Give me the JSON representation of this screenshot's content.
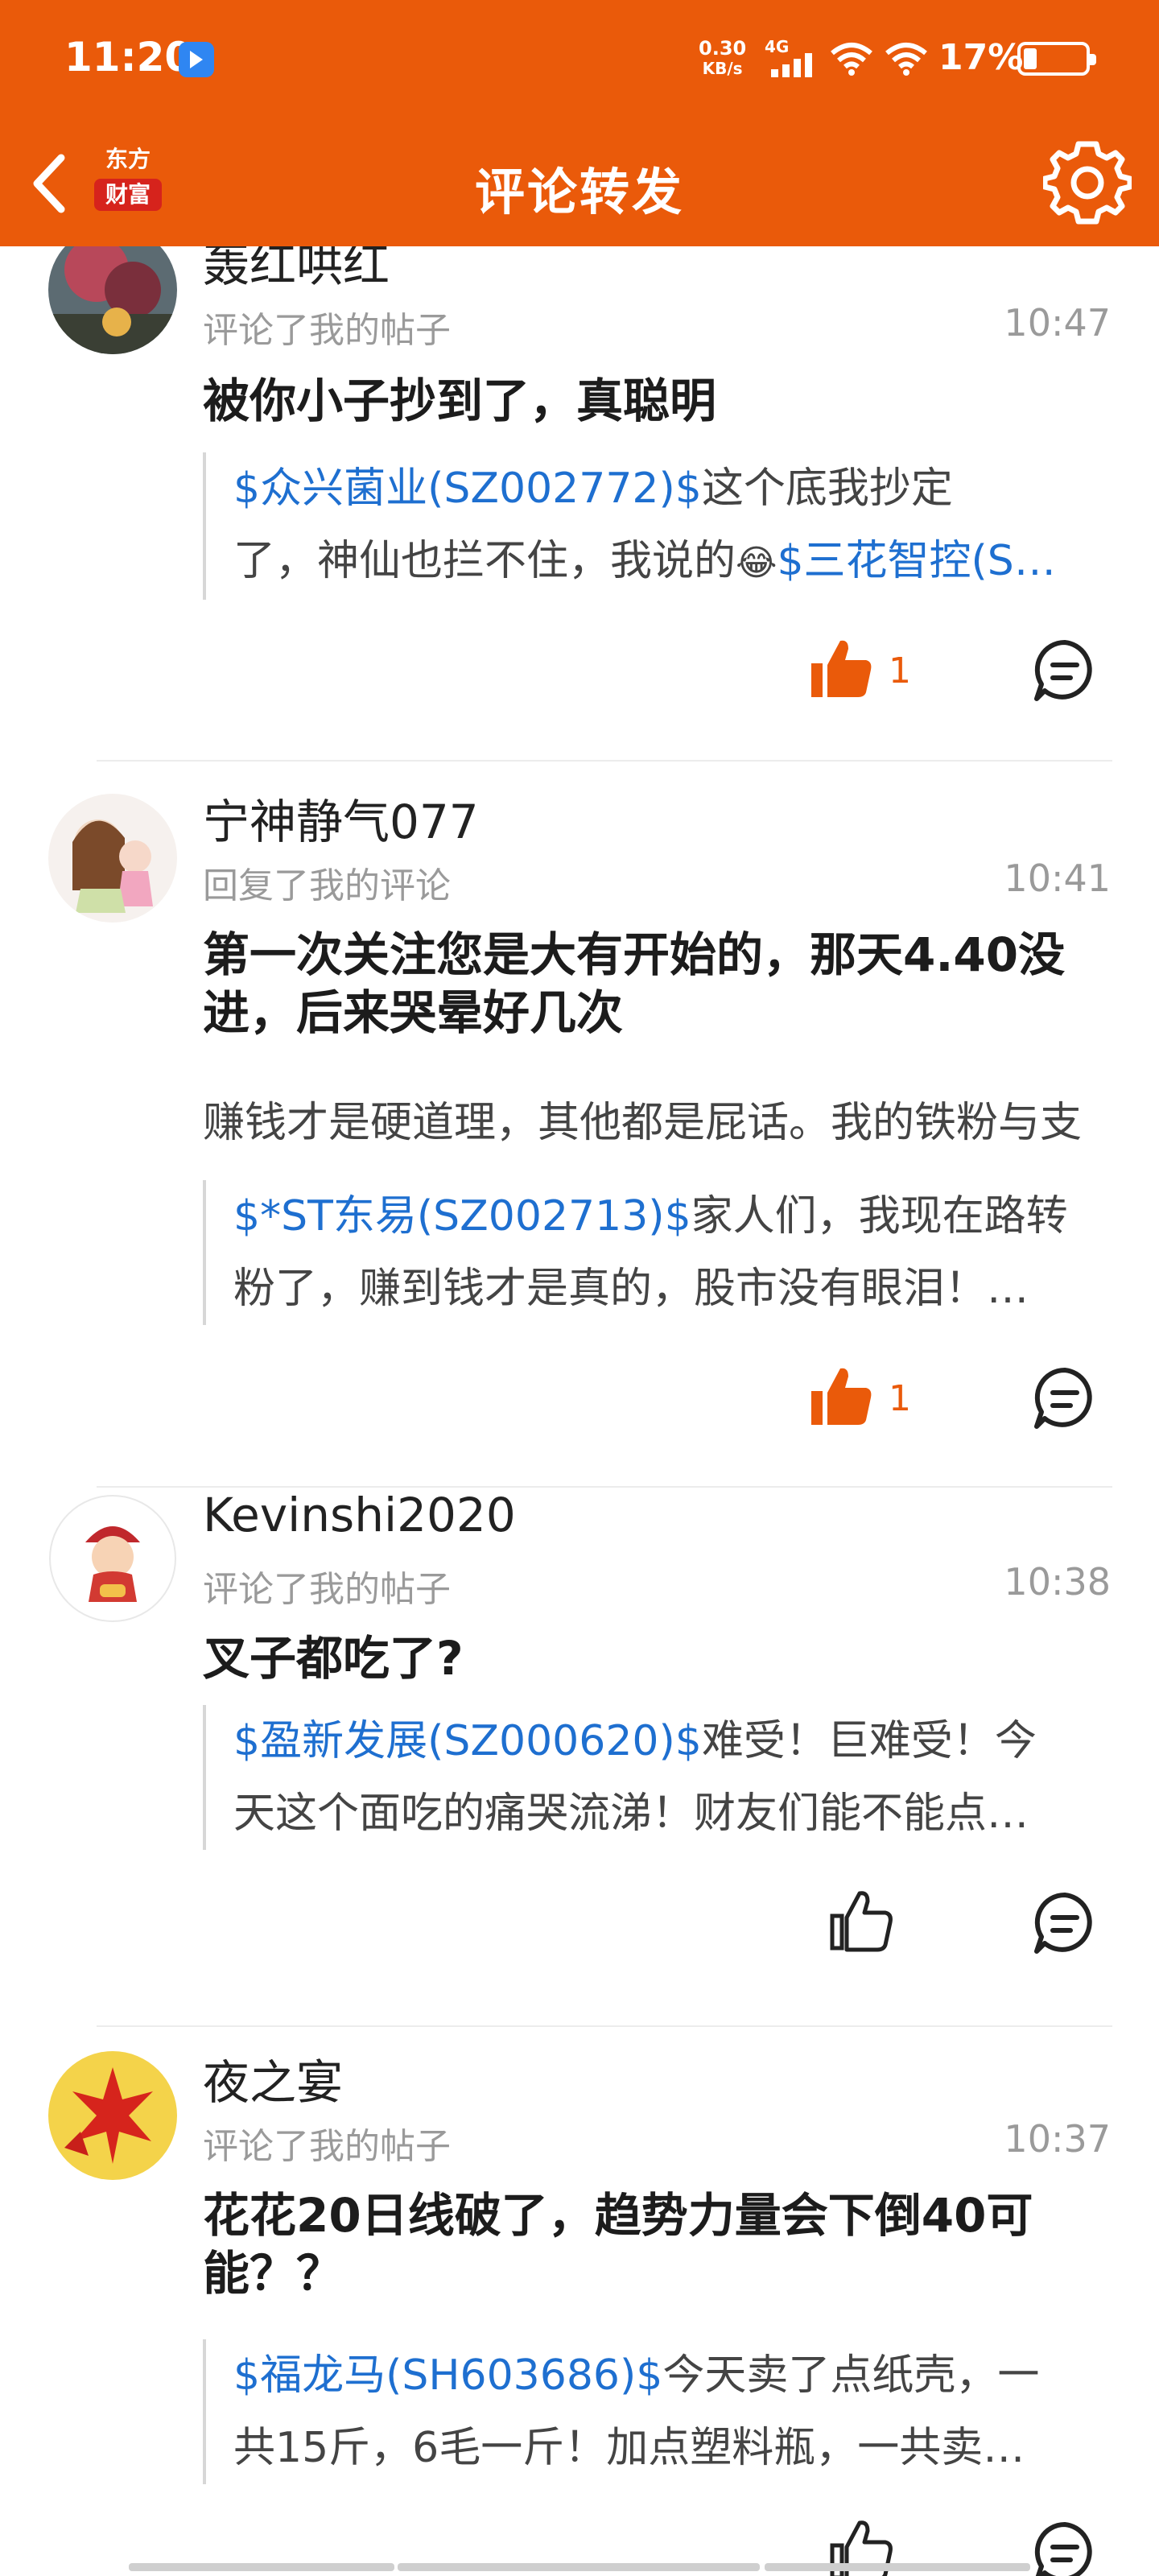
{
  "status_bar": {
    "time": "11:20",
    "net_speed_value": "0.30",
    "net_speed_unit": "KB/s",
    "network": "4G",
    "battery": "17%"
  },
  "header": {
    "logo_line1": "东方",
    "logo_line2": "财富",
    "title": "评论转发",
    "accent_color": "#ea5a0a"
  },
  "items": [
    {
      "user": "轰红哄红",
      "action": "评论了我的帖子",
      "time": "10:47",
      "comment": "被你小子抄到了，真聪明",
      "quote_stock": "$众兴菌业(SZ002772)$",
      "quote_line1": "这个底我抄定",
      "quote_line2": "了，神仙也拦不住，我说的",
      "quote_emoji": "😂",
      "quote_stock2": "$三花智控(S…",
      "likes": "1",
      "liked": true
    },
    {
      "user": "宁神静气077",
      "action": "回复了我的评论",
      "time": "10:41",
      "comment": "第一次关注您是大有开始的，那天4.40没进，后来哭晕好几次",
      "sub": "赚钱才是硬道理，其他都是屁话。我的铁粉与支",
      "quote_stock": "$*ST东易(SZ002713)$",
      "quote_line1": "家人们，我现在路转",
      "quote_line2": "粉了，赚到钱才是真的，股市没有眼泪！…",
      "likes": "1",
      "liked": true
    },
    {
      "user": "Kevinshi2020",
      "action": "评论了我的帖子",
      "time": "10:38",
      "comment": "叉子都吃了?",
      "quote_stock": "$盈新发展(SZ000620)$",
      "quote_line1": "难受！巨难受！今",
      "quote_line2": "天这个面吃的痛哭流涕！财友们能不能点…",
      "likes": "",
      "liked": false
    },
    {
      "user": "夜之宴",
      "action": "评论了我的帖子",
      "time": "10:37",
      "comment": "花花20日线破了，趋势力量会下倒40可能？？",
      "quote_stock": "$福龙马(SH603686)$",
      "quote_line1": "今天卖了点纸壳，一",
      "quote_line2": "共15斤，6毛一斤！加点塑料瓶，一共卖…",
      "likes": "",
      "liked": false
    }
  ]
}
